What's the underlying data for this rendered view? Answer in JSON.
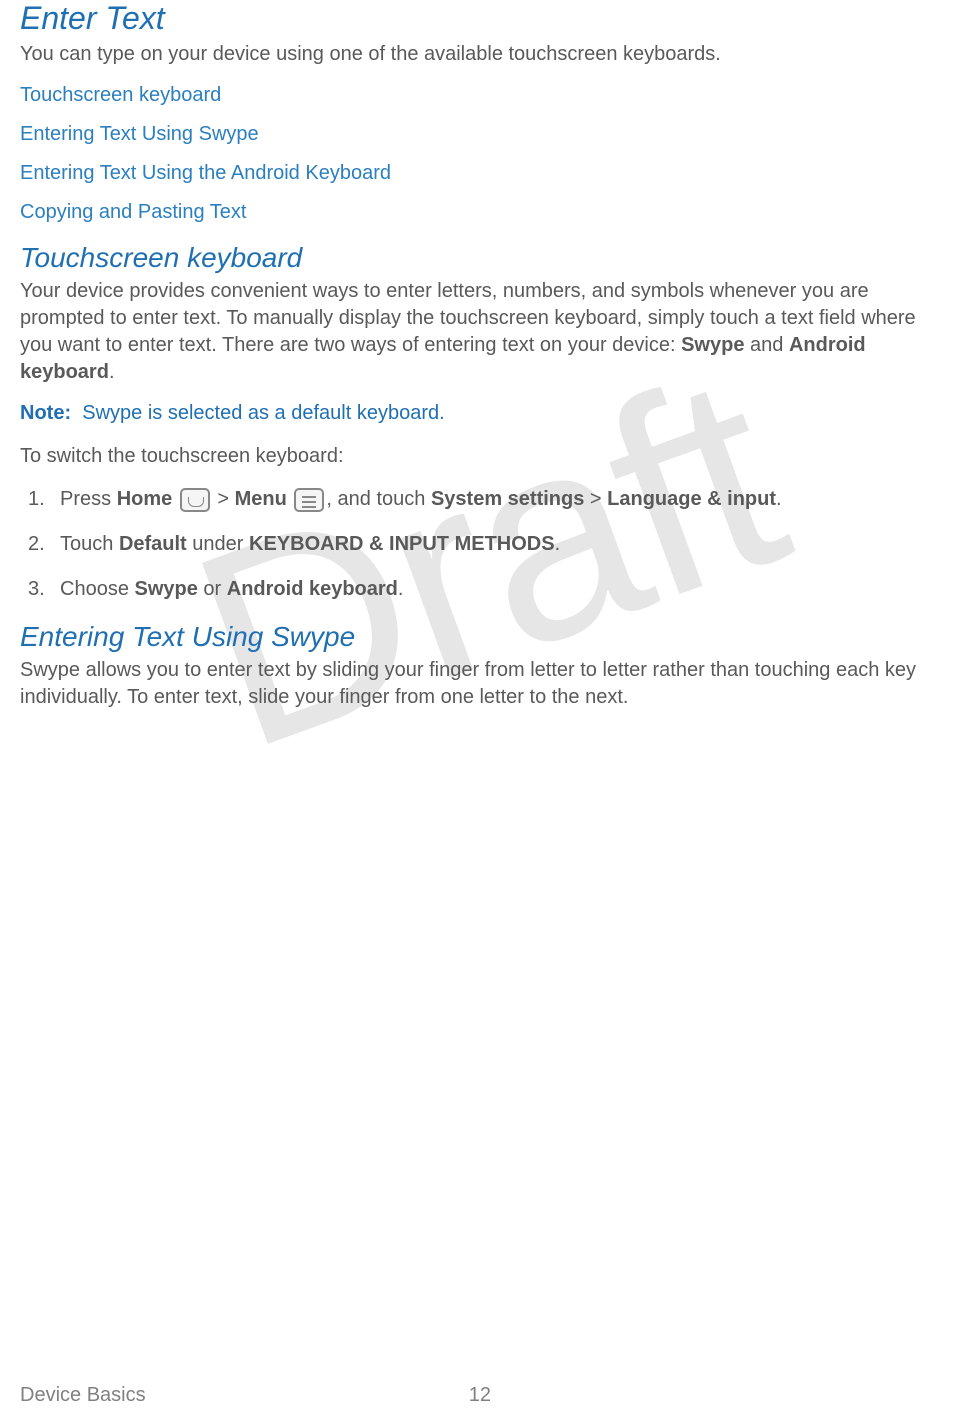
{
  "watermark": "Draft",
  "section1": {
    "title": "Enter Text",
    "intro": "You can type on your device using one of the available touchscreen keyboards."
  },
  "links": {
    "l1": "Touchscreen keyboard",
    "l2": "Entering Text Using Swype",
    "l3": "Entering Text Using the Android Keyboard",
    "l4": "Copying and Pasting Text"
  },
  "section2": {
    "title": "Touchscreen keyboard",
    "p1_part1": "Your device provides convenient ways to enter letters, numbers, and symbols whenever you are prompted to enter text. To manually display the touchscreen keyboard, simply touch a text field where you want to enter text. There are two ways of entering text on your device: ",
    "p1_bold1": "Swype",
    "p1_mid": " and ",
    "p1_bold2": "Android keyboard",
    "p1_end": ".",
    "note_label": "Note:",
    "note_text": "Swype is selected as a default keyboard.",
    "p2": "To switch the touchscreen keyboard:",
    "step1": {
      "num": "1.",
      "t1": "Press ",
      "b1": "Home",
      "t2": " > ",
      "b2": "Menu",
      "t3": ", and touch ",
      "b3": "System settings",
      "t4": " > ",
      "b4": "Language & input",
      "t5": "."
    },
    "step2": {
      "num": "2.",
      "t1": "Touch ",
      "b1": "Default",
      "t2": " under ",
      "b2": "KEYBOARD & INPUT METHODS",
      "t3": "."
    },
    "step3": {
      "num": "3.",
      "t1": "Choose ",
      "b1": "Swype",
      "t2": " or ",
      "b2": "Android keyboard",
      "t3": "."
    }
  },
  "section3": {
    "title": "Entering Text Using Swype",
    "p1": "Swype allows you to enter text by sliding your finger from letter to letter rather than touching each key individually. To enter text, slide your finger from one letter to the next."
  },
  "footer": {
    "title": "Device Basics",
    "page": "12"
  }
}
